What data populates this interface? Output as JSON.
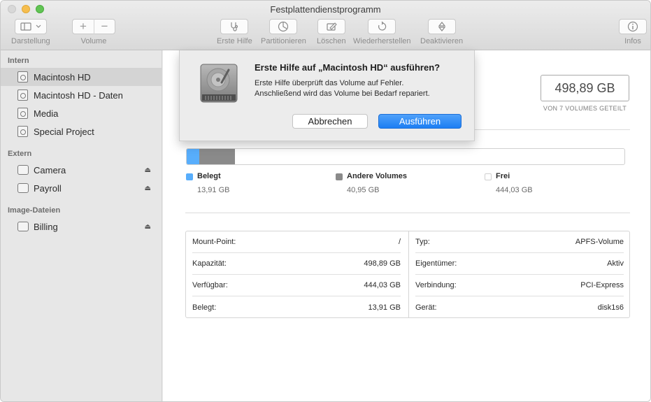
{
  "window": {
    "title": "Festplattendienstprogramm"
  },
  "toolbar": {
    "view_label": "Darstellung",
    "volume_label": "Volume",
    "volume_add": "+",
    "volume_remove": "−",
    "first_aid_label": "Erste Hilfe",
    "partition_label": "Partitionieren",
    "erase_label": "Löschen",
    "restore_label": "Wiederherstellen",
    "unmount_label": "Deaktivieren",
    "info_label": "Infos"
  },
  "sidebar": {
    "sections": [
      {
        "title": "Intern",
        "items": [
          {
            "label": "Macintosh HD",
            "selected": true
          },
          {
            "label": "Macintosh HD - Daten"
          },
          {
            "label": "Media"
          },
          {
            "label": "Special Project"
          }
        ]
      },
      {
        "title": "Extern",
        "items": [
          {
            "label": "Camera",
            "eject": "⏏"
          },
          {
            "label": "Payroll",
            "eject": "⏏"
          }
        ]
      },
      {
        "title": "Image-Dateien",
        "items": [
          {
            "label": "Billing",
            "eject": "⏏"
          }
        ]
      }
    ]
  },
  "main": {
    "capacity": "498,89 GB",
    "capacity_note": "VON 7 VOLUMES GETEILT",
    "usage": {
      "used_fraction": 0.028,
      "other_fraction": 0.082,
      "colors": {
        "used": "#58aefc",
        "other": "#8a8a8a",
        "free": "#ffffff"
      },
      "legend": [
        {
          "name": "Belegt",
          "value": "13,91 GB"
        },
        {
          "name": "Andere Volumes",
          "value": "40,95 GB"
        },
        {
          "name": "Frei",
          "value": "444,03 GB"
        }
      ]
    },
    "info_left": [
      {
        "key": "Mount-Point:",
        "value": "/"
      },
      {
        "key": "Kapazität:",
        "value": "498,89 GB"
      },
      {
        "key": "Verfügbar:",
        "value": "444,03 GB"
      },
      {
        "key": "Belegt:",
        "value": "13,91 GB"
      }
    ],
    "info_right": [
      {
        "key": "Typ:",
        "value": "APFS-Volume"
      },
      {
        "key": "Eigentümer:",
        "value": "Aktiv"
      },
      {
        "key": "Verbindung:",
        "value": "PCI-Express"
      },
      {
        "key": "Gerät:",
        "value": "disk1s6"
      }
    ]
  },
  "dialog": {
    "title": "Erste Hilfe auf „Macintosh HD“ ausführen?",
    "body_line1": "Erste Hilfe überprüft das Volume auf Fehler.",
    "body_line2": "Anschließend wird das Volume bei Bedarf repariert.",
    "cancel_label": "Abbrechen",
    "run_label": "Ausführen"
  }
}
